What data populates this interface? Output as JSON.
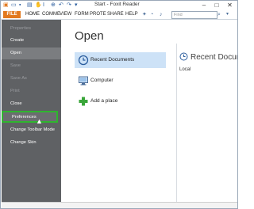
{
  "window": {
    "title": "Start - Foxit Reader",
    "minimize": "–",
    "maximize": "□",
    "close": "✕"
  },
  "menubar": {
    "file": "FILE",
    "items": [
      "HOME",
      "COMME",
      "VIEW",
      "FORM",
      "PROTE",
      "SHARE",
      "HELP"
    ],
    "find_placeholder": "Find"
  },
  "sidebar": {
    "items": [
      {
        "label": "Properties",
        "state": "disabled"
      },
      {
        "label": "Create",
        "state": "enabled"
      },
      {
        "label": "Open",
        "state": "selected"
      },
      {
        "label": "Save",
        "state": "disabled"
      },
      {
        "label": "Save As",
        "state": "disabled"
      },
      {
        "label": "Print",
        "state": "disabled"
      },
      {
        "label": "Close",
        "state": "enabled"
      },
      {
        "label": "Preferences",
        "state": "highlighted"
      },
      {
        "label": "Change Toolbar Mode",
        "state": "enabled"
      },
      {
        "label": "Change Skin",
        "state": "enabled"
      }
    ]
  },
  "main": {
    "heading": "Open",
    "locations": [
      {
        "label": "Recent Documents",
        "icon": "clock-icon",
        "active": true
      },
      {
        "label": "Computer",
        "icon": "computer-icon",
        "active": false
      },
      {
        "label": "Add a place",
        "icon": "plus-icon",
        "active": false
      }
    ],
    "recent": {
      "title": "Recent Docume",
      "subtitle": "Local"
    }
  },
  "colors": {
    "accent": "#e2791f",
    "sidebar": "#5f6164",
    "selected": "#cde2f7",
    "highlight_border": "#2fb52f",
    "add_icon": "#3aa63a"
  }
}
